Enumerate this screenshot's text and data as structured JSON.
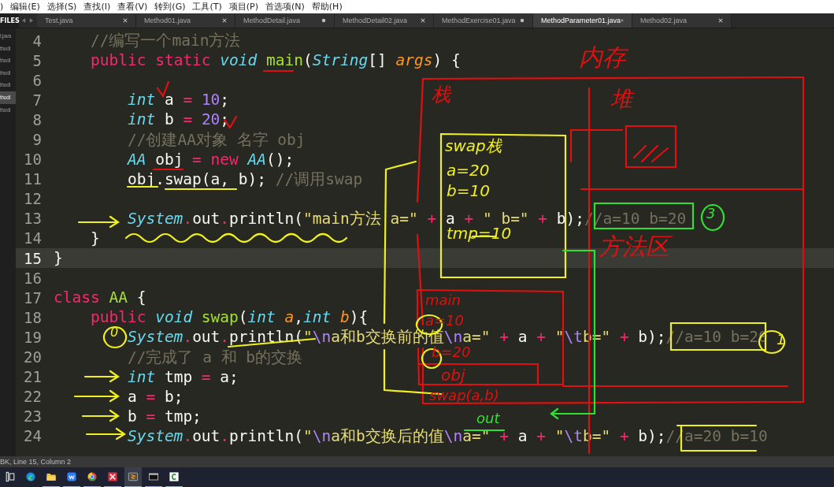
{
  "menu": [
    ")",
    "编辑(E)",
    "选择(S)",
    "查找(I)",
    "查看(V)",
    "转到(G)",
    "工具(T)",
    "项目(P)",
    "首选项(N)",
    "帮助(H)"
  ],
  "sidebar": {
    "label": "FILES",
    "items": [
      {
        "name": "t.java",
        "selected": false
      },
      {
        "name": "thodI",
        "selected": false
      },
      {
        "name": "thodI",
        "selected": false
      },
      {
        "name": "thodI",
        "selected": false
      },
      {
        "name": "thodI",
        "selected": false
      },
      {
        "name": "thodI",
        "selected": true
      },
      {
        "name": "thodI",
        "selected": false
      }
    ]
  },
  "tabs": [
    {
      "title": "Test.java",
      "selected": false,
      "modified": false
    },
    {
      "title": "Method01.java",
      "selected": false,
      "modified": false
    },
    {
      "title": "MethodDetail.java",
      "selected": false,
      "modified": true
    },
    {
      "title": "MethodDetail02.java",
      "selected": false,
      "modified": false
    },
    {
      "title": "MethodExercise01.java",
      "selected": false,
      "modified": true
    },
    {
      "title": "MethodParameter01.java",
      "selected": true,
      "modified": false
    },
    {
      "title": "Method02.java",
      "selected": false,
      "modified": false
    }
  ],
  "code": [
    {
      "number": "4",
      "current": false,
      "tokens": [
        {
          "kind": "cmt",
          "text": "    //编写一个main方法"
        }
      ]
    },
    {
      "number": "5",
      "current": false,
      "tokens": [
        {
          "kind": "kw",
          "text": "    public "
        },
        {
          "kind": "kw",
          "text": "static "
        },
        {
          "kind": "type",
          "text": "void "
        },
        {
          "kind": "fn",
          "text": "main"
        },
        {
          "kind": "plain",
          "text": "("
        },
        {
          "kind": "type",
          "text": "String"
        },
        {
          "kind": "plain",
          "text": "[] "
        },
        {
          "kind": "param",
          "text": "args"
        },
        {
          "kind": "plain",
          "text": ") {"
        }
      ]
    },
    {
      "number": "6",
      "current": false
    },
    {
      "number": "7",
      "current": false,
      "tokens": [
        {
          "kind": "type",
          "text": "        int"
        },
        {
          "kind": "plain",
          "text": " a "
        },
        {
          "kind": "op",
          "text": "= "
        },
        {
          "kind": "num",
          "text": "10"
        },
        {
          "kind": "plain",
          "text": ";"
        }
      ]
    },
    {
      "number": "8",
      "current": false,
      "tokens": [
        {
          "kind": "type",
          "text": "        int"
        },
        {
          "kind": "plain",
          "text": " b "
        },
        {
          "kind": "op",
          "text": "= "
        },
        {
          "kind": "num",
          "text": "20"
        },
        {
          "kind": "plain",
          "text": ";"
        }
      ]
    },
    {
      "number": "9",
      "current": false,
      "tokens": [
        {
          "kind": "cmt",
          "text": "        //创建AA对象 名字 obj"
        }
      ]
    },
    {
      "number": "10",
      "current": false,
      "tokens": [
        {
          "kind": "type",
          "text": "        AA"
        },
        {
          "kind": "plain",
          "text": " obj "
        },
        {
          "kind": "op",
          "text": "= "
        },
        {
          "kind": "kw",
          "text": "new "
        },
        {
          "kind": "type",
          "text": "AA"
        },
        {
          "kind": "plain",
          "text": "();"
        }
      ]
    },
    {
      "number": "11",
      "current": false,
      "tokens": [
        {
          "kind": "plain",
          "text": "        obj.swap(a, b); "
        },
        {
          "kind": "cmt",
          "text": "//调用swap"
        }
      ]
    },
    {
      "number": "12",
      "current": false
    },
    {
      "number": "13",
      "current": false,
      "tokens": [
        {
          "kind": "type",
          "text": "        System"
        },
        {
          "kind": "op",
          "text": "."
        },
        {
          "kind": "plain",
          "text": "out"
        },
        {
          "kind": "op",
          "text": "."
        },
        {
          "kind": "plain",
          "text": "println("
        },
        {
          "kind": "str",
          "text": "\"main方法 a=\" "
        },
        {
          "kind": "op",
          "text": "+"
        },
        {
          "kind": "plain",
          "text": " a "
        },
        {
          "kind": "op",
          "text": "+"
        },
        {
          "kind": "str",
          "text": " \" b=\" "
        },
        {
          "kind": "op",
          "text": "+"
        },
        {
          "kind": "plain",
          "text": " b);"
        },
        {
          "kind": "cmt",
          "text": "//a=10 b=20"
        }
      ]
    },
    {
      "number": "14",
      "current": false,
      "tokens": [
        {
          "kind": "plain",
          "text": "    }"
        }
      ]
    },
    {
      "number": "15",
      "current": true,
      "tokens": [
        {
          "kind": "plain",
          "text": "}"
        }
      ]
    },
    {
      "number": "16",
      "current": false
    },
    {
      "number": "17",
      "current": false,
      "tokens": [
        {
          "kind": "kw",
          "text": "class "
        },
        {
          "kind": "fn",
          "text": "AA"
        },
        {
          "kind": "plain",
          "text": " {"
        }
      ]
    },
    {
      "number": "18",
      "current": false,
      "tokens": [
        {
          "kind": "kw",
          "text": "    public "
        },
        {
          "kind": "type",
          "text": "void "
        },
        {
          "kind": "fn",
          "text": "swap"
        },
        {
          "kind": "plain",
          "text": "("
        },
        {
          "kind": "type",
          "text": "int "
        },
        {
          "kind": "param",
          "text": "a"
        },
        {
          "kind": "plain",
          "text": ","
        },
        {
          "kind": "type",
          "text": "int "
        },
        {
          "kind": "param",
          "text": "b"
        },
        {
          "kind": "plain",
          "text": "){"
        }
      ]
    },
    {
      "number": "19",
      "current": false,
      "tokens": [
        {
          "kind": "type",
          "text": "        System"
        },
        {
          "kind": "op",
          "text": "."
        },
        {
          "kind": "plain",
          "text": "out"
        },
        {
          "kind": "op",
          "text": "."
        },
        {
          "kind": "plain",
          "text": "println("
        },
        {
          "kind": "str",
          "text": "\""
        },
        {
          "kind": "esc",
          "text": "\\n"
        },
        {
          "kind": "str",
          "text": "a和b交换前的值"
        },
        {
          "kind": "esc",
          "text": "\\n"
        },
        {
          "kind": "str",
          "text": "a=\" "
        },
        {
          "kind": "op",
          "text": "+"
        },
        {
          "kind": "plain",
          "text": " a "
        },
        {
          "kind": "op",
          "text": "+"
        },
        {
          "kind": "str",
          "text": " \""
        },
        {
          "kind": "esc",
          "text": "\\t"
        },
        {
          "kind": "str",
          "text": "b=\" "
        },
        {
          "kind": "op",
          "text": "+"
        },
        {
          "kind": "plain",
          "text": " b);"
        },
        {
          "kind": "cmt",
          "text": "//a=10 b=20"
        }
      ]
    },
    {
      "number": "20",
      "current": false,
      "tokens": [
        {
          "kind": "cmt",
          "text": "        //完成了 a 和 b的交换"
        }
      ]
    },
    {
      "number": "21",
      "current": false,
      "tokens": [
        {
          "kind": "type",
          "text": "        int"
        },
        {
          "kind": "plain",
          "text": " tmp "
        },
        {
          "kind": "op",
          "text": "="
        },
        {
          "kind": "plain",
          "text": " a;"
        }
      ]
    },
    {
      "number": "22",
      "current": false,
      "tokens": [
        {
          "kind": "plain",
          "text": "        a "
        },
        {
          "kind": "op",
          "text": "="
        },
        {
          "kind": "plain",
          "text": " b;"
        }
      ]
    },
    {
      "number": "23",
      "current": false,
      "tokens": [
        {
          "kind": "plain",
          "text": "        b "
        },
        {
          "kind": "op",
          "text": "="
        },
        {
          "kind": "plain",
          "text": " tmp;"
        }
      ]
    },
    {
      "number": "24",
      "current": false,
      "tokens": [
        {
          "kind": "type",
          "text": "        System"
        },
        {
          "kind": "op",
          "text": "."
        },
        {
          "kind": "plain",
          "text": "out"
        },
        {
          "kind": "op",
          "text": "."
        },
        {
          "kind": "plain",
          "text": "println("
        },
        {
          "kind": "str",
          "text": "\""
        },
        {
          "kind": "esc",
          "text": "\\n"
        },
        {
          "kind": "str",
          "text": "a和b交换后的值"
        },
        {
          "kind": "esc",
          "text": "\\n"
        },
        {
          "kind": "str",
          "text": "a=\" "
        },
        {
          "kind": "op",
          "text": "+"
        },
        {
          "kind": "plain",
          "text": " a "
        },
        {
          "kind": "op",
          "text": "+"
        },
        {
          "kind": "str",
          "text": " \""
        },
        {
          "kind": "esc",
          "text": "\\t"
        },
        {
          "kind": "str",
          "text": "b=\" "
        },
        {
          "kind": "op",
          "text": "+"
        },
        {
          "kind": "plain",
          "text": " b);"
        },
        {
          "kind": "cmt",
          "text": "//a=20 b=10"
        }
      ]
    }
  ],
  "notes": [
    {
      "text": "内存",
      "color": "#e01010"
    },
    {
      "text": "堆",
      "color": "#e01010"
    },
    {
      "text": "栈",
      "color": "#e01010"
    },
    {
      "text": "方法区",
      "color": "#e01010"
    },
    {
      "text": "swap栈",
      "color": "#f0f020"
    },
    {
      "text": "a=20",
      "color": "#f0f020"
    },
    {
      "text": "b=10",
      "color": "#f0f020"
    },
    {
      "text": "tmp=10",
      "color": "#f0f020"
    },
    {
      "text": "main",
      "color": "#e01010"
    },
    {
      "text": "a=10",
      "color": "#e01010"
    },
    {
      "text": "b=20",
      "color": "#e01010"
    },
    {
      "text": "obj",
      "color": "#e01010"
    },
    {
      "text": "swap(a,b)",
      "color": "#e01010"
    },
    {
      "text": "out",
      "color": "#30e030"
    },
    {
      "text": "3",
      "color": "#30e030"
    },
    {
      "text": "1",
      "color": "#f0f020"
    },
    {
      "text": "0",
      "color": "#f0f020"
    }
  ],
  "status_bar": "BK, Line 15, Column 2",
  "taskbar": [
    {
      "kind": "taskview",
      "active": false,
      "running": false
    },
    {
      "kind": "edge",
      "active": false,
      "running": false
    },
    {
      "kind": "folder",
      "active": false,
      "running": true
    },
    {
      "kind": "wps",
      "active": false,
      "running": true
    },
    {
      "kind": "chrome",
      "active": false,
      "running": true
    },
    {
      "kind": "xmind",
      "active": false,
      "running": true
    },
    {
      "kind": "sublime",
      "active": true,
      "running": true
    },
    {
      "kind": "terminal",
      "active": false,
      "running": true
    },
    {
      "kind": "camtasia",
      "active": false,
      "running": true
    }
  ]
}
